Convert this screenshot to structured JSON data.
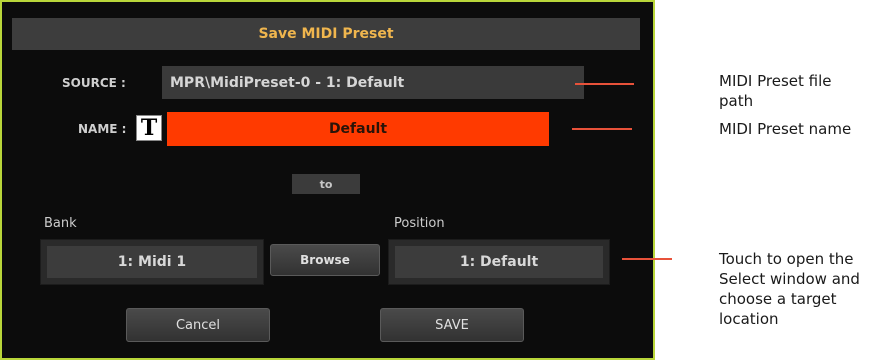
{
  "dialog": {
    "title": "Save MIDI Preset",
    "source_label": "SOURCE :",
    "source_value": "MPR\\MidiPreset-0 - 1: Default",
    "name_label": "NAME :",
    "name_value": "Default",
    "to_label": "to",
    "bank_label": "Bank",
    "bank_value": "1: Midi 1",
    "browse_label": "Browse",
    "position_label": "Position",
    "position_value": "1: Default",
    "cancel_label": "Cancel",
    "save_label": "SAVE"
  },
  "callouts": {
    "file_path_line1": "MIDI Preset file",
    "file_path_line2": "path",
    "name": "MIDI Preset name",
    "select_line1": "Touch to open the",
    "select_line2": "Select window and",
    "select_line3": "choose a target",
    "select_line4": "location"
  },
  "colors": {
    "frame": "#b9d63a",
    "title_text": "#f0b64e",
    "name_field": "#ff3a00",
    "callout_line": "#e8523a"
  },
  "icons": {
    "text_edit": "T"
  }
}
